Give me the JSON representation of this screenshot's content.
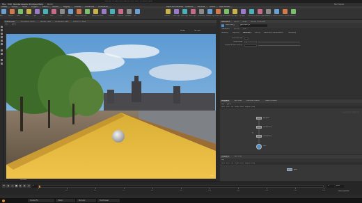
{
  "window": {
    "title": "Houdini FX Non-Commercial 16.0.504 - untitled.hipnc"
  },
  "menubar": {
    "items": [
      "File",
      "Edit",
      "Render",
      "Assets",
      "Windows",
      "Help"
    ],
    "build": "Build",
    "desktop": "Technical"
  },
  "shelf": {
    "tabs": [
      "Create",
      "Modify",
      "Model",
      "Polygon",
      "Deform",
      "Texture",
      "Rigging",
      "Muscles",
      "Characters",
      "Constraints"
    ],
    "right_tabs": [
      "Lights and Cameras",
      "Collisions",
      "Particles",
      "Grains",
      "Rigid Bodies"
    ],
    "tools": [
      "Box",
      "Sphere",
      "Tube",
      "Torus",
      "Grid",
      "Null",
      "Line",
      "Circle",
      "Curve",
      "Draw Curve",
      "Path",
      "Spray Paint",
      "Font",
      "Platonic",
      "L-System",
      "Metaball",
      "File"
    ],
    "right_tools": [
      "Camera",
      "Point Light",
      "Spot Light",
      "Area Light",
      "Geometry Light",
      "Volume Light",
      "Distant Light",
      "Environment Light",
      "Sky Light",
      "GI Light",
      "Caustic Light",
      "Portal Light",
      "Ambient Light",
      "Stereo Camera",
      "VR Camera",
      "Switcher"
    ]
  },
  "viewport": {
    "tabs": [
      "Scene View",
      "Animation Editor",
      "Render View",
      "Composite View",
      "Motion FX View"
    ],
    "path": "obj",
    "object": "geo1",
    "camera": "No cam",
    "view": "Persp",
    "bottom_label": "untitled",
    "corner": "Indie"
  },
  "params": {
    "tabs": [
      "Geometry",
      "Parms",
      "Takes",
      "Render Scheduler"
    ],
    "node_type": "Geometry",
    "node_name": "geometry1",
    "section_tabs": [
      "Transform",
      "Render",
      "Misc"
    ],
    "sub_tabs": [
      "Shading",
      "Lighting",
      "Geometry",
      "Dicing",
      "Geometry Manipulation",
      "Sampling"
    ],
    "rows": [
      {
        "label": "Dice Normal",
        "value": ""
      },
      {
        "label": "Dice Mode",
        "value": "1"
      },
      {
        "label": "Displacement Bound",
        "value": ""
      }
    ]
  },
  "network": {
    "tabs": [
      "/obj/geo1",
      "Tree View",
      "Material Palette",
      "Asset Browser"
    ],
    "path": "obj",
    "object": "geo1",
    "menu": [
      "Add",
      "Edit",
      "Go",
      "View",
      "Tools",
      "Layout",
      "Help"
    ],
    "nodes": [
      "sphere1",
      "transform1",
      "mountain1",
      "OUT"
    ],
    "watermark": "Geometry"
  },
  "lower": {
    "tabs": [
      "/obj/geo1",
      "Tree View"
    ],
    "path": "obj",
    "menu": [
      "Add",
      "Edit",
      "Go",
      "View",
      "Tools",
      "Layout",
      "Help"
    ],
    "node": "geo1"
  },
  "timeline": {
    "frame": "1",
    "start": "1",
    "end": "240",
    "ticks": [
      "1",
      "24",
      "48",
      "72",
      "96",
      "120",
      "144",
      "168",
      "192",
      "216",
      "240"
    ],
    "auto_update": "Auto Update"
  },
  "taskbar": {
    "items": [
      "Houdini FX",
      "Firefox",
      "Terminal",
      "File Browser"
    ]
  },
  "colors": {
    "plane_yellow": "#e6b93b",
    "sky": "#6da5d6",
    "accent_orange": "#e08a2a",
    "node_blue": "#4f8ec9"
  }
}
